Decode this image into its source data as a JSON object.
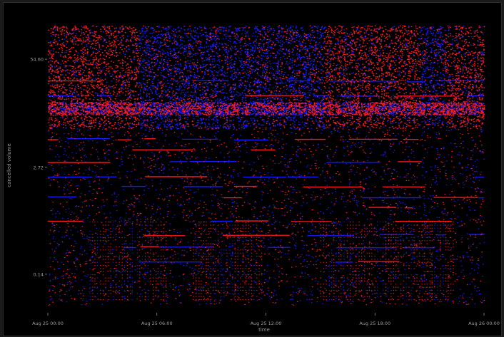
{
  "chart_data": {
    "type": "scatter",
    "title": "",
    "xlabel": "time",
    "ylabel": "cancelled volume",
    "y_scale": "log",
    "ylim": [
      0.05,
      150
    ],
    "x_ticks": [
      "Aug 25 00:00",
      "Aug 25 06:00",
      "Aug 25 12:00",
      "Aug 25 18:00",
      "Aug 26 00:00"
    ],
    "y_ticks": [
      {
        "label": "54.60",
        "value": 54.6
      },
      {
        "label": "2.72",
        "value": 2.72
      },
      {
        "label": "0.14",
        "value": 0.14
      }
    ],
    "xlim": [
      "Aug 25 00:00",
      "Aug 26 00:00"
    ],
    "grid": false,
    "legend": "none",
    "background": "#000000",
    "series": [
      {
        "color": "#ff1a1a"
      },
      {
        "color": "#1a1aff"
      }
    ]
  }
}
